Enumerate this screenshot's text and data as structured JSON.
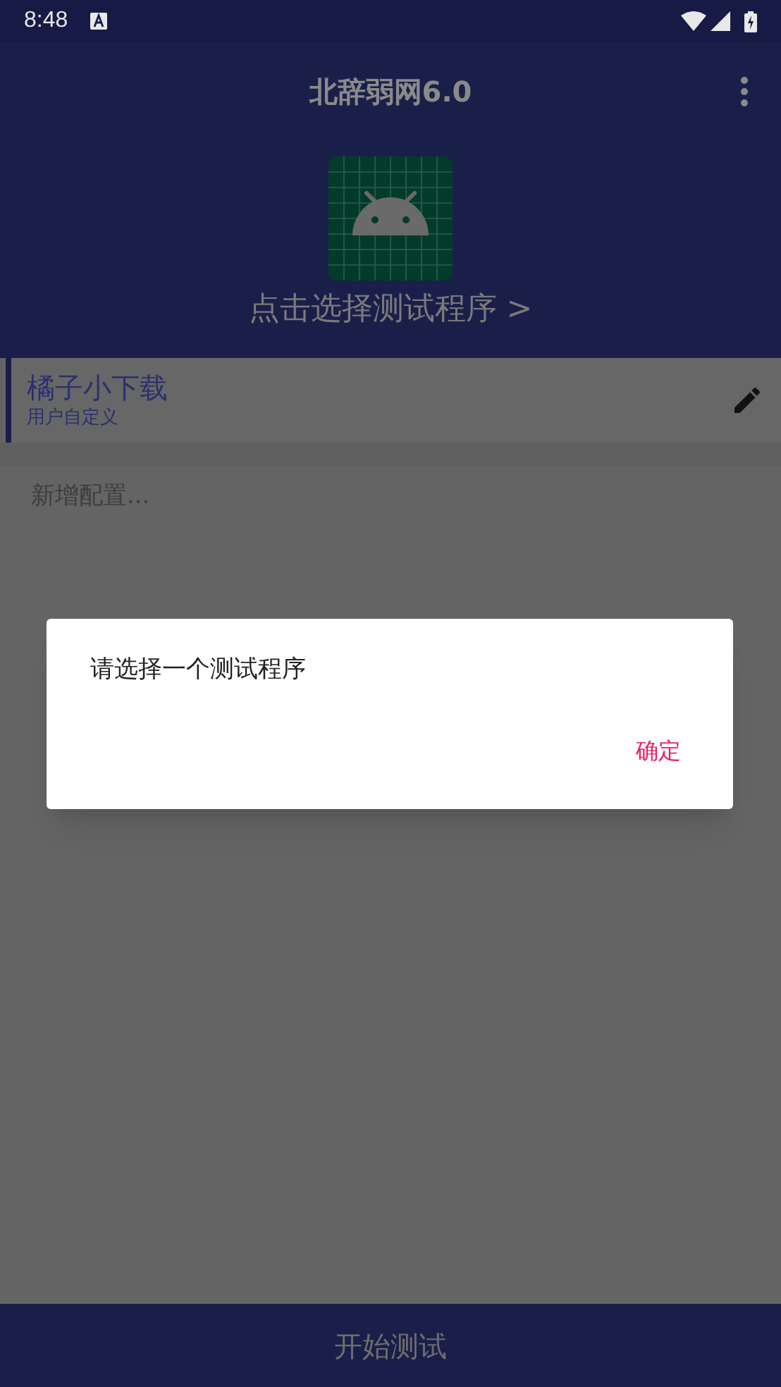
{
  "status_bar": {
    "time": "8:48"
  },
  "app_bar": {
    "title": "北辞弱网6.0"
  },
  "program_picker": {
    "label": "点击选择测试程序 >"
  },
  "configs": [
    {
      "title": "橘子小下载",
      "subtitle": "用户自定义",
      "selected": true
    }
  ],
  "add_config": {
    "label": "新增配置..."
  },
  "dialog": {
    "message": "请选择一个测试程序",
    "button": "确定"
  },
  "bottom_button": {
    "label": "开始测试"
  }
}
